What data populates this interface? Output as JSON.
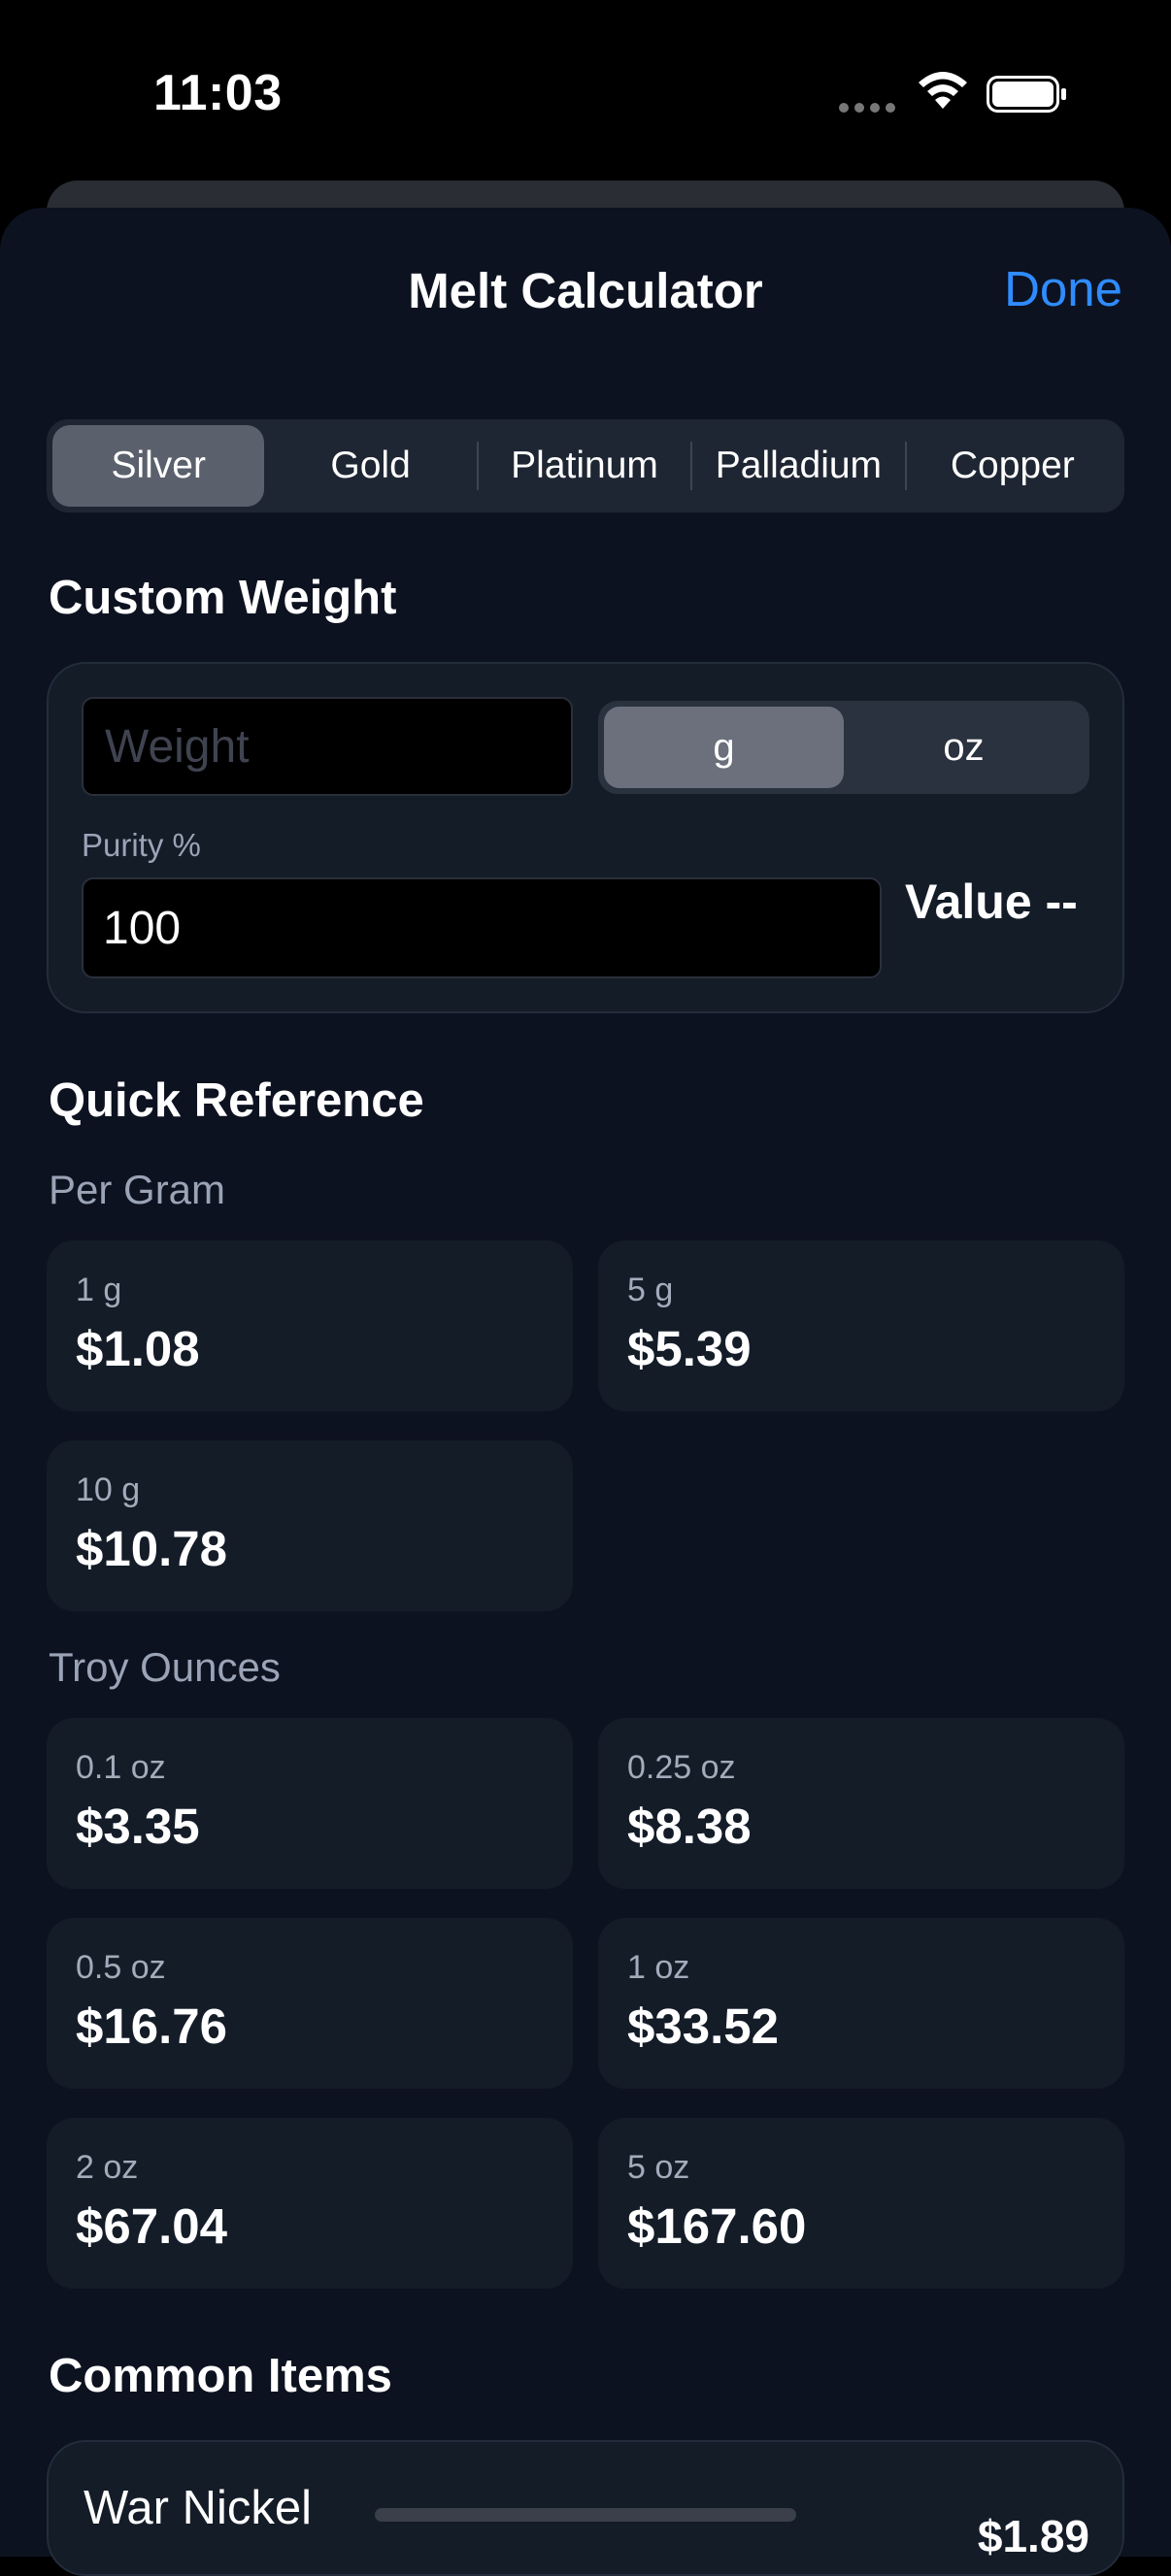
{
  "status": {
    "time": "11:03"
  },
  "nav": {
    "title": "Melt Calculator",
    "done_label": "Done"
  },
  "metals": {
    "items": [
      "Silver",
      "Gold",
      "Platinum",
      "Palladium",
      "Copper"
    ],
    "selected": "Silver"
  },
  "custom_weight": {
    "title": "Custom Weight",
    "weight_placeholder": "Weight",
    "weight_value": "",
    "units": [
      "g",
      "oz"
    ],
    "selected_unit": "g",
    "purity_label": "Purity %",
    "purity_value": "100",
    "value_text": "Value --"
  },
  "quick_reference": {
    "title": "Quick Reference",
    "per_gram_title": "Per Gram",
    "per_gram": [
      {
        "label": "1 g",
        "value": "$1.08"
      },
      {
        "label": "5 g",
        "value": "$5.39"
      },
      {
        "label": "10 g",
        "value": "$10.78"
      }
    ],
    "troy_title": "Troy Ounces",
    "troy": [
      {
        "label": "0.1 oz",
        "value": "$3.35"
      },
      {
        "label": "0.25 oz",
        "value": "$8.38"
      },
      {
        "label": "0.5 oz",
        "value": "$16.76"
      },
      {
        "label": "1 oz",
        "value": "$33.52"
      },
      {
        "label": "2 oz",
        "value": "$67.04"
      },
      {
        "label": "5 oz",
        "value": "$167.60"
      }
    ]
  },
  "common_items": {
    "title": "Common Items",
    "items": [
      {
        "name": "War Nickel",
        "price": "$1.89"
      }
    ]
  },
  "colors": {
    "accent": "#2f8cff",
    "background": "#0d1220",
    "card": "#141c28"
  }
}
